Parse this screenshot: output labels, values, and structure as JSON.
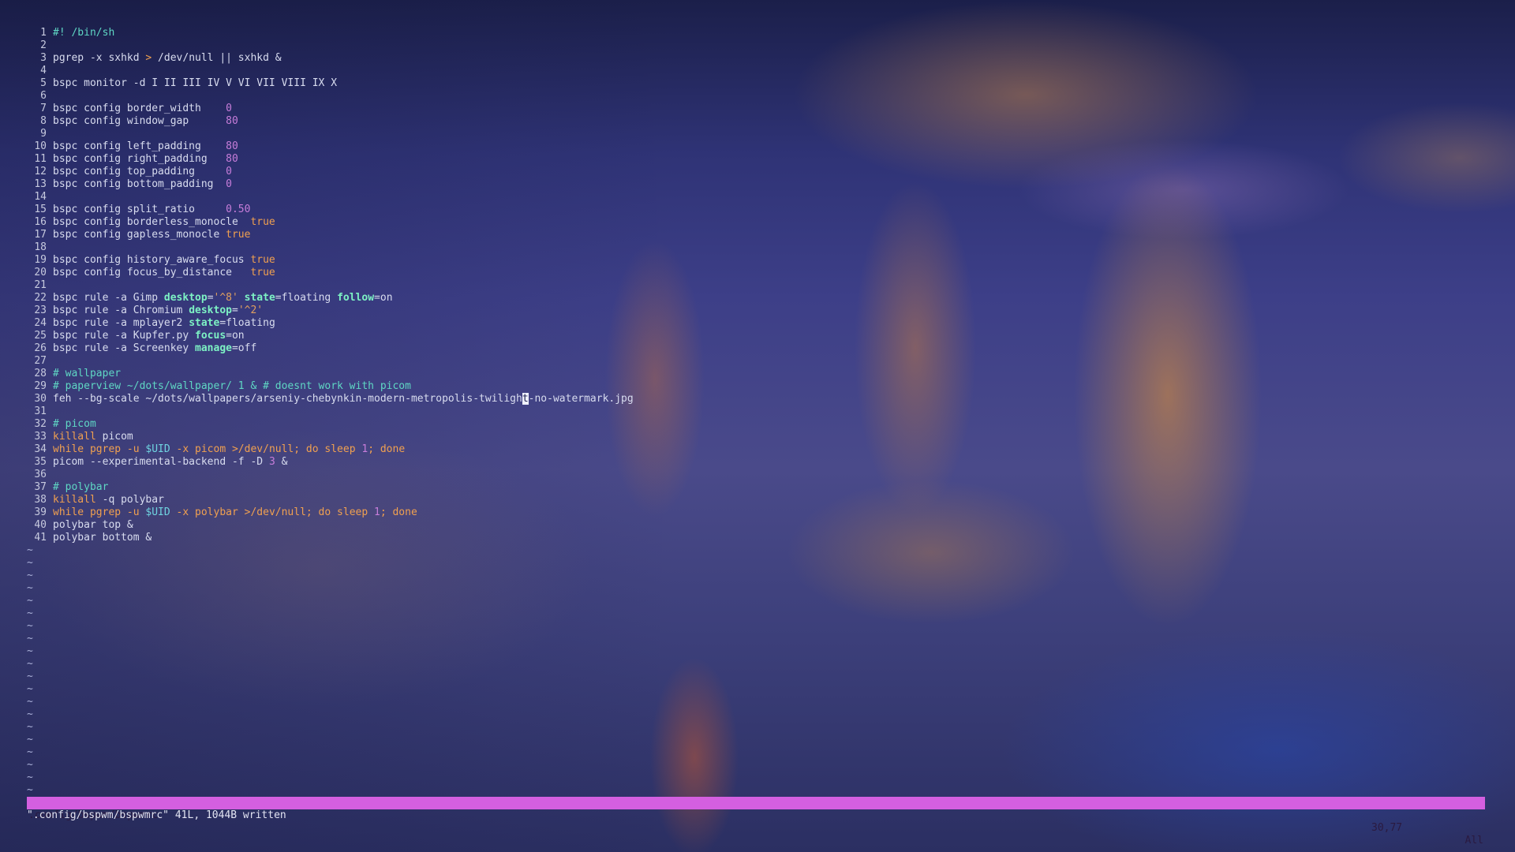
{
  "editor": {
    "lines": [
      {
        "n": "1",
        "parts": [
          {
            "t": "#! /bin/sh",
            "c": "cm"
          }
        ]
      },
      {
        "n": "2",
        "parts": []
      },
      {
        "n": "3",
        "parts": [
          {
            "t": "pgrep -x sxhkd "
          },
          {
            "t": ">",
            "c": "shk"
          },
          {
            "t": " /dev/null || sxhkd &"
          }
        ]
      },
      {
        "n": "4",
        "parts": []
      },
      {
        "n": "5",
        "parts": [
          {
            "t": "bspc monitor -d I II III IV V VI VII VIII IX X"
          }
        ]
      },
      {
        "n": "6",
        "parts": []
      },
      {
        "n": "7",
        "parts": [
          {
            "t": "bspc config border_width    "
          },
          {
            "t": "0",
            "c": "num"
          }
        ]
      },
      {
        "n": "8",
        "parts": [
          {
            "t": "bspc config window_gap      "
          },
          {
            "t": "80",
            "c": "num"
          }
        ]
      },
      {
        "n": "9",
        "parts": []
      },
      {
        "n": "10",
        "parts": [
          {
            "t": "bspc config left_padding    "
          },
          {
            "t": "80",
            "c": "num"
          }
        ]
      },
      {
        "n": "11",
        "parts": [
          {
            "t": "bspc config right_padding   "
          },
          {
            "t": "80",
            "c": "num"
          }
        ]
      },
      {
        "n": "12",
        "parts": [
          {
            "t": "bspc config top_padding     "
          },
          {
            "t": "0",
            "c": "num"
          }
        ]
      },
      {
        "n": "13",
        "parts": [
          {
            "t": "bspc config bottom_padding  "
          },
          {
            "t": "0",
            "c": "num"
          }
        ]
      },
      {
        "n": "14",
        "parts": []
      },
      {
        "n": "15",
        "parts": [
          {
            "t": "bspc config split_ratio     "
          },
          {
            "t": "0.50",
            "c": "num"
          }
        ]
      },
      {
        "n": "16",
        "parts": [
          {
            "t": "bspc config borderless_monocle  "
          },
          {
            "t": "true",
            "c": "bool"
          }
        ]
      },
      {
        "n": "17",
        "parts": [
          {
            "t": "bspc config gapless_monocle "
          },
          {
            "t": "true",
            "c": "bool"
          }
        ]
      },
      {
        "n": "18",
        "parts": []
      },
      {
        "n": "19",
        "parts": [
          {
            "t": "bspc config history_aware_focus "
          },
          {
            "t": "true",
            "c": "bool"
          }
        ]
      },
      {
        "n": "20",
        "parts": [
          {
            "t": "bspc config focus_by_distance   "
          },
          {
            "t": "true",
            "c": "bool"
          }
        ]
      },
      {
        "n": "21",
        "parts": []
      },
      {
        "n": "22",
        "parts": [
          {
            "t": "bspc rule -a Gimp "
          },
          {
            "t": "desktop",
            "c": "kw"
          },
          {
            "t": "="
          },
          {
            "t": "'^8'",
            "c": "str"
          },
          {
            "t": " "
          },
          {
            "t": "state",
            "c": "kw"
          },
          {
            "t": "=floating "
          },
          {
            "t": "follow",
            "c": "kw"
          },
          {
            "t": "=on"
          }
        ]
      },
      {
        "n": "23",
        "parts": [
          {
            "t": "bspc rule -a Chromium "
          },
          {
            "t": "desktop",
            "c": "kw"
          },
          {
            "t": "="
          },
          {
            "t": "'^2'",
            "c": "str"
          }
        ]
      },
      {
        "n": "24",
        "parts": [
          {
            "t": "bspc rule -a mplayer2 "
          },
          {
            "t": "state",
            "c": "kw"
          },
          {
            "t": "=floating"
          }
        ]
      },
      {
        "n": "25",
        "parts": [
          {
            "t": "bspc rule -a Kupfer.py "
          },
          {
            "t": "focus",
            "c": "kw"
          },
          {
            "t": "=on"
          }
        ]
      },
      {
        "n": "26",
        "parts": [
          {
            "t": "bspc rule -a Screenkey "
          },
          {
            "t": "manage",
            "c": "kw"
          },
          {
            "t": "=off"
          }
        ]
      },
      {
        "n": "27",
        "parts": []
      },
      {
        "n": "28",
        "parts": [
          {
            "t": "# wallpaper",
            "c": "cm"
          }
        ]
      },
      {
        "n": "29",
        "parts": [
          {
            "t": "# paperview ~/dots/wallpaper/ 1 & # doesnt work with picom",
            "c": "cm"
          }
        ]
      },
      {
        "n": "30",
        "parts": [
          {
            "t": "feh --bg-scale ~/dots/wallpapers/arseniy-chebynkin-modern-metropolis-twiligh"
          },
          {
            "t": "t",
            "c": "cursor"
          },
          {
            "t": "-no-watermark.jpg"
          }
        ]
      },
      {
        "n": "31",
        "parts": []
      },
      {
        "n": "32",
        "parts": [
          {
            "t": "# picom",
            "c": "cm"
          }
        ]
      },
      {
        "n": "33",
        "parts": [
          {
            "t": "killall",
            "c": "shk"
          },
          {
            "t": " picom"
          }
        ]
      },
      {
        "n": "34",
        "parts": [
          {
            "t": "while pgrep -u ",
            "c": "shk"
          },
          {
            "t": "$UID",
            "c": "var"
          },
          {
            "t": " -x picom >/dev/null; do sleep ",
            "c": "shk"
          },
          {
            "t": "1",
            "c": "num"
          },
          {
            "t": "; done",
            "c": "shk"
          }
        ]
      },
      {
        "n": "35",
        "parts": [
          {
            "t": "picom --experimental-backend -f -D "
          },
          {
            "t": "3",
            "c": "num"
          },
          {
            "t": " &"
          }
        ]
      },
      {
        "n": "36",
        "parts": []
      },
      {
        "n": "37",
        "parts": [
          {
            "t": "# polybar",
            "c": "cm"
          }
        ]
      },
      {
        "n": "38",
        "parts": [
          {
            "t": "killall",
            "c": "shk"
          },
          {
            "t": " -q polybar"
          }
        ]
      },
      {
        "n": "39",
        "parts": [
          {
            "t": "while pgrep -u ",
            "c": "shk"
          },
          {
            "t": "$UID",
            "c": "var"
          },
          {
            "t": " -x polybar >/dev/null; do sleep ",
            "c": "shk"
          },
          {
            "t": "1",
            "c": "num"
          },
          {
            "t": "; done",
            "c": "shk"
          }
        ]
      },
      {
        "n": "40",
        "parts": [
          {
            "t": "polybar top &"
          }
        ]
      },
      {
        "n": "41",
        "parts": [
          {
            "t": "polybar bottom &"
          }
        ]
      }
    ],
    "tilde_char": "~",
    "tilde_count": 20
  },
  "statusline": {
    "file": ".config/bspwm/bspwmrc",
    "position": "30,77",
    "scroll": "All"
  },
  "message": "\".config/bspwm/bspwmrc\" 41L, 1044B written",
  "colors": {
    "statusline_bg": "#d45fe0",
    "comment": "#5fd7c4",
    "number": "#c77dda",
    "boolean": "#f0a050",
    "keyword": "#7df2c4"
  }
}
